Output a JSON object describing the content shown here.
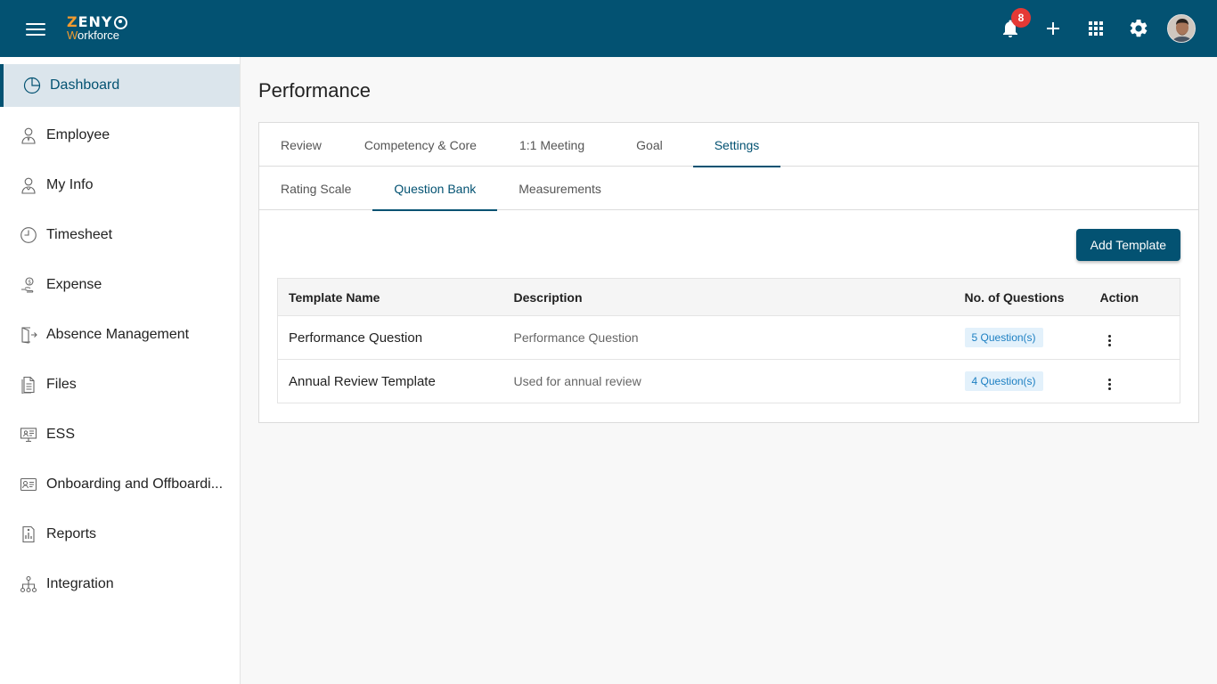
{
  "app": {
    "logo_top": "ZENY",
    "logo_bottom": "Workforce",
    "notifications_count": "8"
  },
  "sidebar": {
    "items": [
      {
        "label": "Dashboard",
        "icon": "pie-chart-icon",
        "active": true
      },
      {
        "label": "Employee",
        "icon": "employee-icon"
      },
      {
        "label": "My Info",
        "icon": "person-icon"
      },
      {
        "label": "Timesheet",
        "icon": "clock-icon"
      },
      {
        "label": "Expense",
        "icon": "money-hand-icon"
      },
      {
        "label": "Absence Management",
        "icon": "exit-door-icon"
      },
      {
        "label": "Files",
        "icon": "file-icon"
      },
      {
        "label": "ESS",
        "icon": "monitor-icon"
      },
      {
        "label": "Onboarding and Offboardi...",
        "icon": "id-card-icon"
      },
      {
        "label": "Reports",
        "icon": "report-icon"
      },
      {
        "label": "Integration",
        "icon": "hierarchy-icon"
      }
    ]
  },
  "page": {
    "title": "Performance"
  },
  "tabs": [
    "Review",
    "Competency & Core",
    "1:1 Meeting",
    "Goal",
    "Settings"
  ],
  "active_tab": "Settings",
  "subtabs": [
    "Rating Scale",
    "Question Bank",
    "Measurements"
  ],
  "active_subtab": "Question Bank",
  "actions": {
    "add_template": "Add Template"
  },
  "table": {
    "headers": [
      "Template Name",
      "Description",
      "No. of Questions",
      "Action"
    ],
    "rows": [
      {
        "name": "Performance Question",
        "description": "Performance Question",
        "questions": "5 Question(s)"
      },
      {
        "name": "Annual Review Template",
        "description": "Used for annual review",
        "questions": "4 Question(s)"
      }
    ]
  },
  "colors": {
    "primary": "#035272",
    "accent": "#f39b2f",
    "badge": "#e53935",
    "chip_bg": "#e3f1fb",
    "chip_text": "#1c7fc2"
  }
}
